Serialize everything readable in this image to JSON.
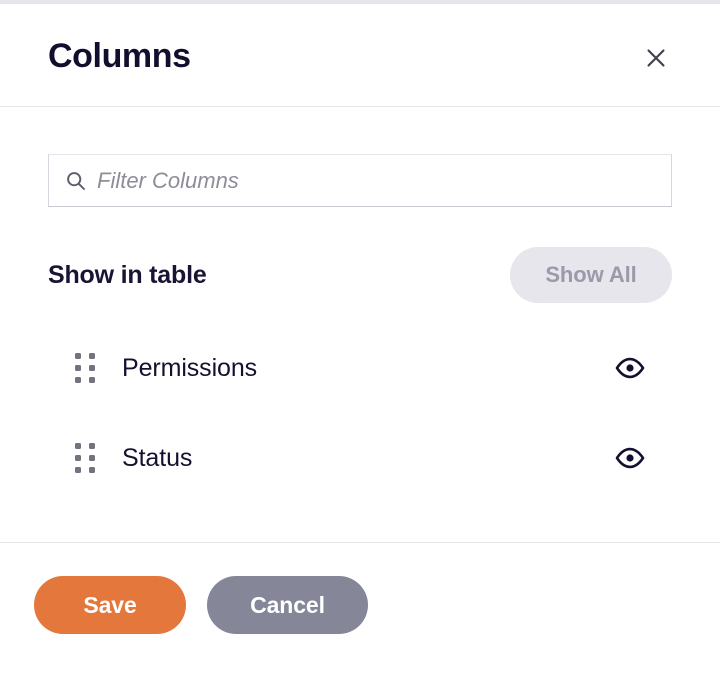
{
  "dialog": {
    "title": "Columns",
    "close_icon": "close-icon"
  },
  "filter": {
    "icon": "search-icon",
    "value": "",
    "placeholder": "Filter Columns"
  },
  "section": {
    "label": "Show in table",
    "show_all_label": "Show All"
  },
  "columns": [
    {
      "name": "Permissions",
      "drag_icon": "drag-handle-icon",
      "visibility_icon": "eye-icon",
      "visible": true
    },
    {
      "name": "Status",
      "drag_icon": "drag-handle-icon",
      "visibility_icon": "eye-icon",
      "visible": true
    }
  ],
  "footer": {
    "save_label": "Save",
    "cancel_label": "Cancel"
  },
  "colors": {
    "title": "#120f2e",
    "save_button": "#e4783c",
    "cancel_button": "#868699",
    "show_all_bg": "#e6e6ec",
    "show_all_text": "#9a9aab",
    "placeholder": "#8d8d99",
    "divider": "#e7e7ec"
  }
}
